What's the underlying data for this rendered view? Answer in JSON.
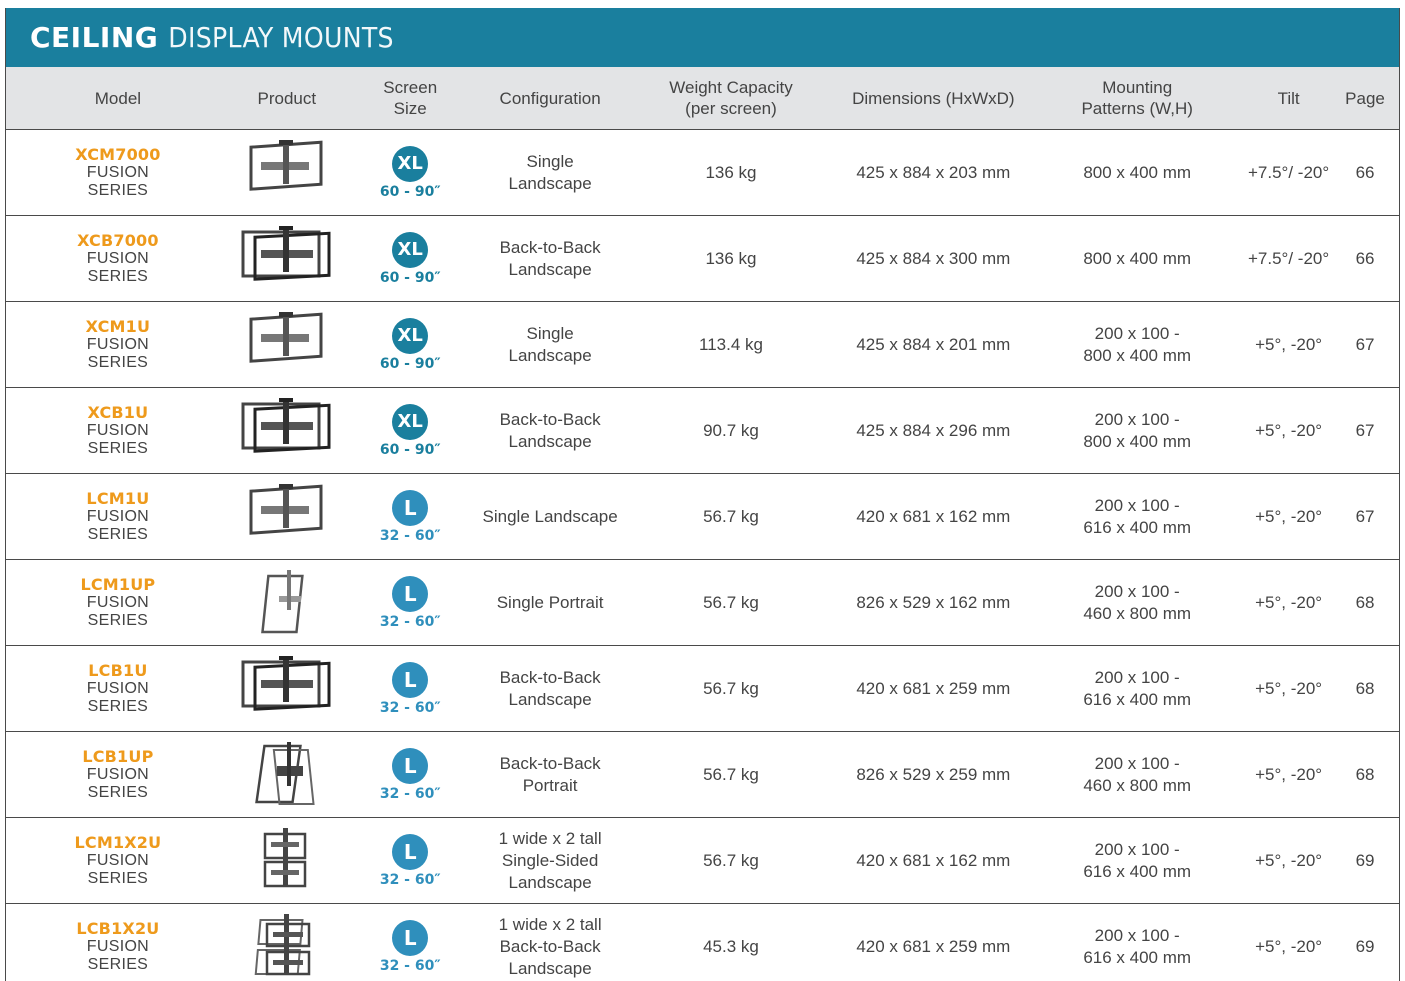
{
  "title": {
    "bold": "CEILING",
    "light": "DISPLAY MOUNTS"
  },
  "colors": {
    "brand_teal": "#1a7f9e",
    "model_orange": "#ee9a1c",
    "header_gray": "#e3e4e6"
  },
  "headers": {
    "model": "Model",
    "product": "Product",
    "screen_size": [
      "Screen",
      "Size"
    ],
    "configuration": "Configuration",
    "weight": [
      "Weight Capacity",
      "(per screen)"
    ],
    "dimensions": "Dimensions (HxWxD)",
    "mounting": [
      "Mounting",
      "Patterns (W,H)"
    ],
    "tilt": "Tilt",
    "page": "Page"
  },
  "rows": [
    {
      "model": "XCM7000",
      "series": [
        "FUSION",
        "SERIES"
      ],
      "product_icon": "single-landscape-mount",
      "size_badge": "XL",
      "size_range": "60 - 90″",
      "config": [
        "Single",
        "Landscape"
      ],
      "weight": "136 kg",
      "dimensions": "425 x 884 x 203 mm",
      "mounting": [
        "800 x 400 mm"
      ],
      "tilt": "+7.5°/ -20°",
      "page": "66"
    },
    {
      "model": "XCB7000",
      "series": [
        "FUSION",
        "SERIES"
      ],
      "product_icon": "back-to-back-landscape-mount",
      "size_badge": "XL",
      "size_range": "60 - 90″",
      "config": [
        "Back-to-Back",
        "Landscape"
      ],
      "weight": "136 kg",
      "dimensions": "425 x 884 x 300 mm",
      "mounting": [
        "800 x 400 mm"
      ],
      "tilt": "+7.5°/ -20°",
      "page": "66"
    },
    {
      "model": "XCM1U",
      "series": [
        "FUSION",
        "SERIES"
      ],
      "product_icon": "single-landscape-mount",
      "size_badge": "XL",
      "size_range": "60 - 90″",
      "config": [
        "Single",
        "Landscape"
      ],
      "weight": "113.4 kg",
      "dimensions": "425 x 884 x 201 mm",
      "mounting": [
        "200 x 100 -",
        "800 x 400 mm"
      ],
      "tilt": "+5°, -20°",
      "page": "67"
    },
    {
      "model": "XCB1U",
      "series": [
        "FUSION",
        "SERIES"
      ],
      "product_icon": "back-to-back-landscape-mount",
      "size_badge": "XL",
      "size_range": "60 - 90″",
      "config": [
        "Back-to-Back",
        "Landscape"
      ],
      "weight": "90.7 kg",
      "dimensions": "425 x 884 x 296 mm",
      "mounting": [
        "200 x 100 -",
        "800 x 400 mm"
      ],
      "tilt": "+5°, -20°",
      "page": "67"
    },
    {
      "model": "LCM1U",
      "series": [
        "FUSION",
        "SERIES"
      ],
      "product_icon": "single-landscape-mount",
      "size_badge": "L",
      "size_range": "32 - 60″",
      "config": [
        "Single Landscape"
      ],
      "weight": "56.7 kg",
      "dimensions": "420 x 681 x 162 mm",
      "mounting": [
        "200 x 100 -",
        "616 x 400 mm"
      ],
      "tilt": "+5°, -20°",
      "page": "67"
    },
    {
      "model": "LCM1UP",
      "series": [
        "FUSION",
        "SERIES"
      ],
      "product_icon": "single-portrait-mount",
      "size_badge": "L",
      "size_range": "32 - 60″",
      "config": [
        "Single Portrait"
      ],
      "weight": "56.7 kg",
      "dimensions": "826 x 529 x 162 mm",
      "mounting": [
        "200 x 100 -",
        "460 x 800 mm"
      ],
      "tilt": "+5°, -20°",
      "page": "68"
    },
    {
      "model": "LCB1U",
      "series": [
        "FUSION",
        "SERIES"
      ],
      "product_icon": "back-to-back-landscape-mount",
      "size_badge": "L",
      "size_range": "32 - 60″",
      "config": [
        "Back-to-Back",
        "Landscape"
      ],
      "weight": "56.7 kg",
      "dimensions": "420 x 681 x 259 mm",
      "mounting": [
        "200 x 100 -",
        "616 x 400 mm"
      ],
      "tilt": "+5°, -20°",
      "page": "68"
    },
    {
      "model": "LCB1UP",
      "series": [
        "FUSION",
        "SERIES"
      ],
      "product_icon": "back-to-back-portrait-mount",
      "size_badge": "L",
      "size_range": "32 - 60″",
      "config": [
        "Back-to-Back",
        "Portrait"
      ],
      "weight": "56.7 kg",
      "dimensions": "826 x 529 x 259 mm",
      "mounting": [
        "200 x 100 -",
        "460 x 800 mm"
      ],
      "tilt": "+5°, -20°",
      "page": "68"
    },
    {
      "model": "LCM1X2U",
      "series": [
        "FUSION",
        "SERIES"
      ],
      "product_icon": "stacked-single-mount",
      "size_badge": "L",
      "size_range": "32 - 60″",
      "config": [
        "1 wide x 2 tall",
        "Single-Sided",
        "Landscape"
      ],
      "weight": "56.7 kg",
      "dimensions": "420 x 681 x 162 mm",
      "mounting": [
        "200 x 100 -",
        "616 x 400 mm"
      ],
      "tilt": "+5°, -20°",
      "page": "69"
    },
    {
      "model": "LCB1X2U",
      "series": [
        "FUSION",
        "SERIES"
      ],
      "product_icon": "stacked-back-to-back-mount",
      "size_badge": "L",
      "size_range": "32 - 60″",
      "config": [
        "1 wide x 2 tall",
        "Back-to-Back",
        "Landscape"
      ],
      "weight": "45.3 kg",
      "dimensions": "420 x 681 x 259 mm",
      "mounting": [
        "200 x 100 -",
        "616 x 400 mm"
      ],
      "tilt": "+5°, -20°",
      "page": "69"
    }
  ]
}
